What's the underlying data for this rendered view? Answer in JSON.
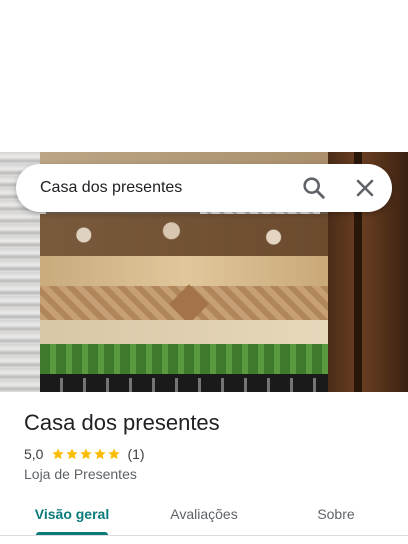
{
  "search": {
    "query": "Casa dos presentes"
  },
  "place": {
    "name": "Casa dos presentes",
    "rating": "5,0",
    "stars": 5,
    "reviews": "(1)",
    "category": "Loja de Presentes"
  },
  "tabs": [
    {
      "label": "Visão geral",
      "active": true
    },
    {
      "label": "Avaliações",
      "active": false
    },
    {
      "label": "Sobre",
      "active": false
    }
  ],
  "colors": {
    "accent": "#0b7a7a",
    "star": "#fbbc04"
  },
  "icons": {
    "search": "search-icon",
    "close": "close-icon",
    "star": "star-icon"
  }
}
